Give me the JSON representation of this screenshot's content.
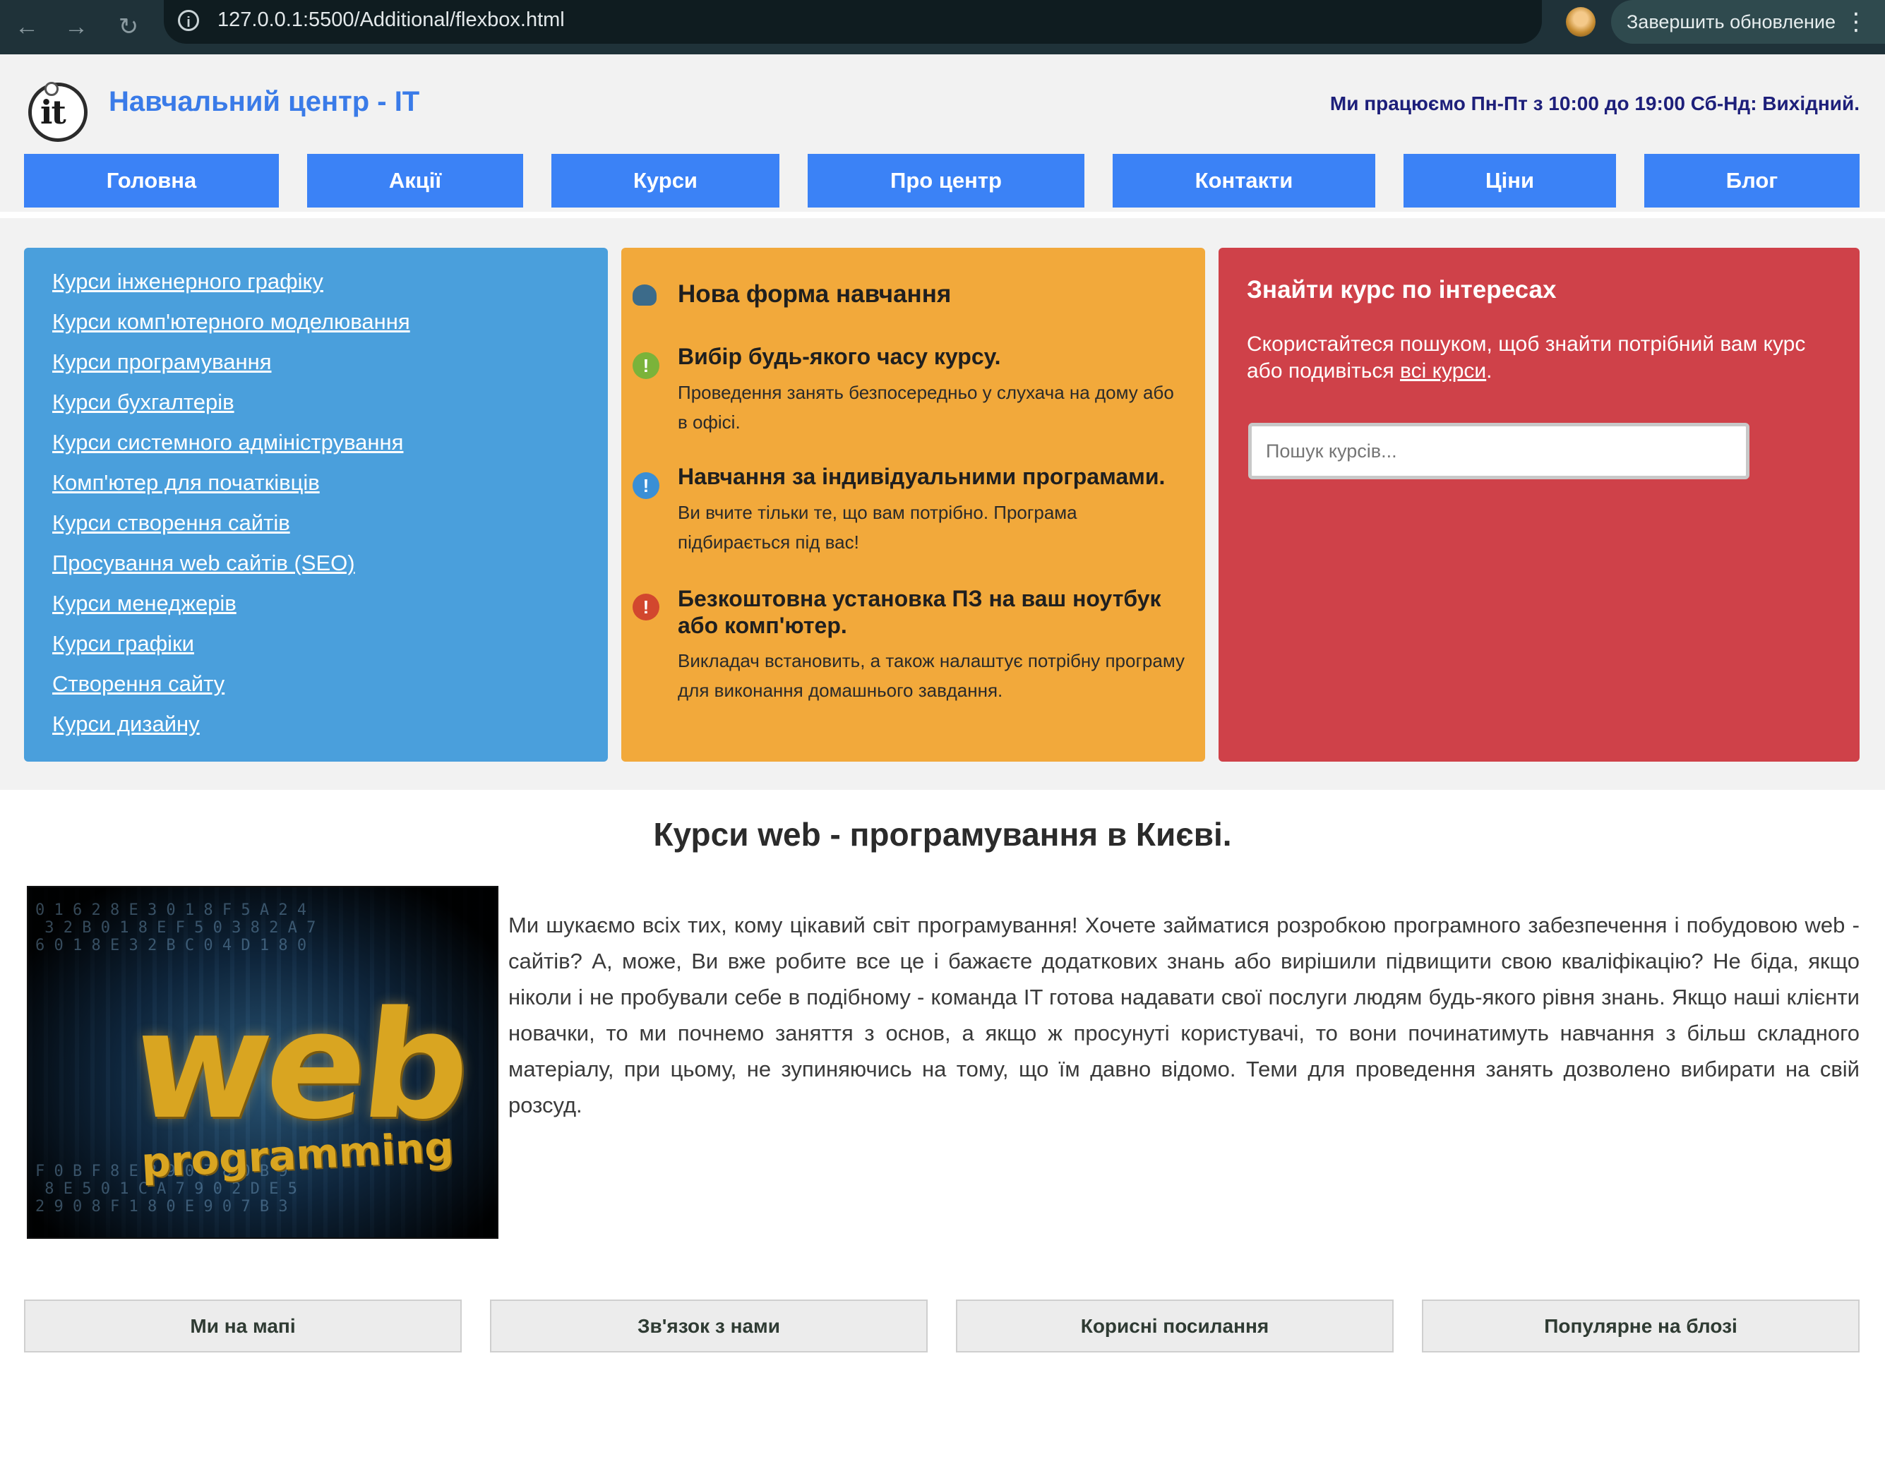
{
  "browser": {
    "url": "127.0.0.1:5500/Additional/flexbox.html",
    "update_label": "Завершить обновление"
  },
  "header": {
    "logo_text": "it",
    "title": "Навчальний центр - IT",
    "work_hours": "Ми працюємо Пн-Пт з 10:00 до 19:00 Сб-Нд: Вихідний."
  },
  "menu": [
    "Головна",
    "Акції",
    "Курси",
    "Про центр",
    "Контакти",
    "Ціни",
    "Блог"
  ],
  "courses": [
    "Курси інженерного графіку",
    "Курси комп'ютерного моделювання",
    "Курси програмування",
    "Курси бухгалтерів",
    "Курси системного адміністрування",
    "Комп'ютер для початківців",
    "Курси створення сайтів",
    "Просування web сайтів (SEO)",
    "Курси менеджерів",
    "Курси графіки",
    "Створення сайту",
    "Курси дизайну"
  ],
  "features": {
    "heading": "Нова форма навчання",
    "items": [
      {
        "title": "Вибір будь-якого часу курсу.",
        "text": "Проведення занять безпосередньо у слухача на дому або в офісі.",
        "icon": "green-info-icon",
        "color": "#7bb33a"
      },
      {
        "title": "Навчання за індивідуальними програмами.",
        "text": "Ви вчите тільки те, що вам потрібно. Програма підбирається під вас!",
        "icon": "blue-info-icon",
        "color": "#3a8fd6"
      },
      {
        "title": "Безкоштовна установка ПЗ на ваш ноутбук або комп'ютер.",
        "text": "Викладач встановить, а також налаштує потрібну програму для виконання домашнього завдання.",
        "icon": "red-alert-icon",
        "color": "#d2472e"
      }
    ]
  },
  "search": {
    "title": "Знайти курс по інтересах",
    "text_before": "Скористайтеся пошуком, щоб знайти потрібний вам курс або подивіться ",
    "link": "всі курси",
    "text_after": ".",
    "placeholder": "Пошук курсів..."
  },
  "main": {
    "heading": "Курси web - програмування в Києві.",
    "image_text_big": "web",
    "image_text_small": "programming",
    "paragraph": "Ми шукаємо всіх тих, кому цікавий світ програмування! Хочете займатися розробкою програмного забезпечення і побудовою web - сайтів? А, може, Ви вже робите все це і бажаєте додаткових знань або вирішили підвищити свою кваліфікацію? Не біда, якщо ніколи і не пробували себе в подібному - команда IT готова надавати свої послуги людям будь-якого рівня знань. Якщо наші клієнти новачки, то ми почнемо заняття з основ, а якщо ж просунуті користувачі, то вони починатимуть навчання з більш складного матеріалу, при цьому, не зупиняючись на тому, що їм давно відомо. Теми для проведення занять дозволено вибирати на свій розсуд."
  },
  "footer": [
    "Ми на мапі",
    "Зв'язок з нами",
    "Корисні посилання",
    "Популярне на блозі"
  ],
  "colors": {
    "menu": "#3b82f6",
    "panel_blue": "#4a9fdc",
    "panel_orange": "#f2a93b",
    "panel_red": "#cf4149"
  }
}
